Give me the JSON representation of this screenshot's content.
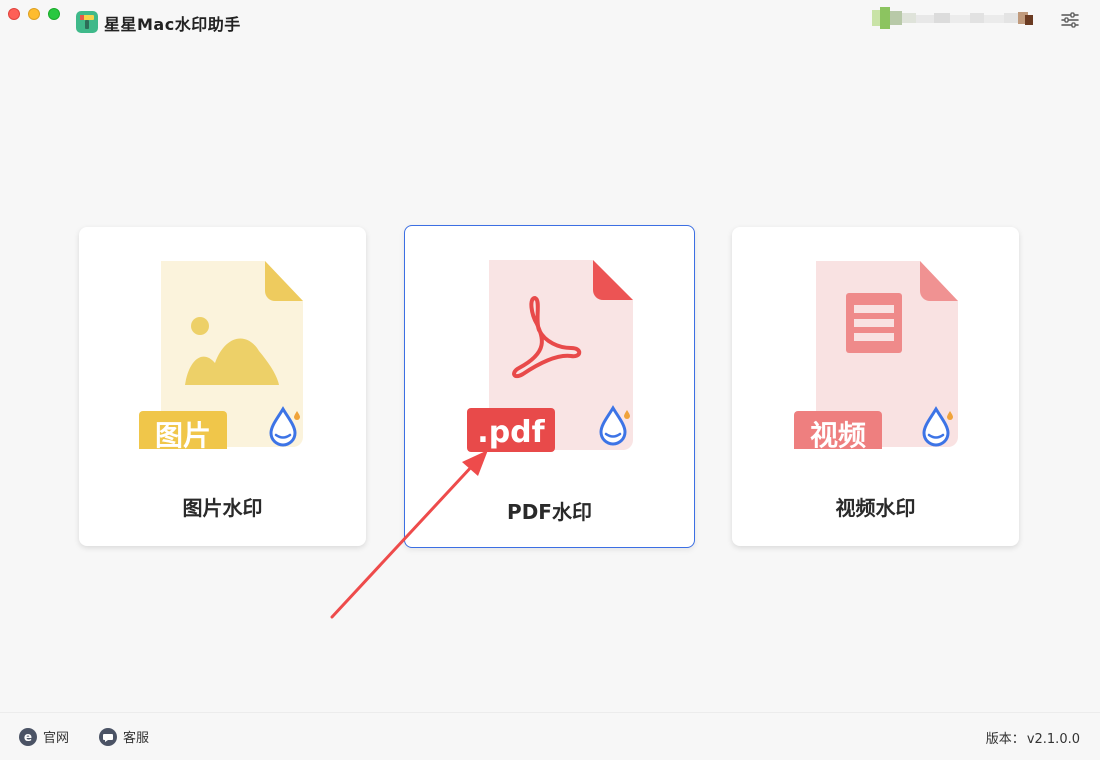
{
  "app": {
    "title": "星星Mac水印助手",
    "brand_color": "#3c6fe3"
  },
  "cards": [
    {
      "label": "图片水印",
      "badge": "图片",
      "icon": "image-file-icon",
      "tint": "#fbf3dc",
      "accent": "#f0c64a"
    },
    {
      "label": "PDF水印",
      "badge": ".pdf",
      "icon": "pdf-file-icon",
      "tint": "#f9e4e4",
      "accent": "#e84a4a"
    },
    {
      "label": "视频水印",
      "badge": "视频",
      "icon": "video-file-icon",
      "tint": "#f9e2e2",
      "accent": "#ee7f7f"
    }
  ],
  "footer": {
    "site_label": "官网",
    "service_label": "客服",
    "version_label": "版本：",
    "version_value": "v2.1.0.0"
  },
  "annotation": {
    "arrow_color": "#ee4b4b"
  }
}
